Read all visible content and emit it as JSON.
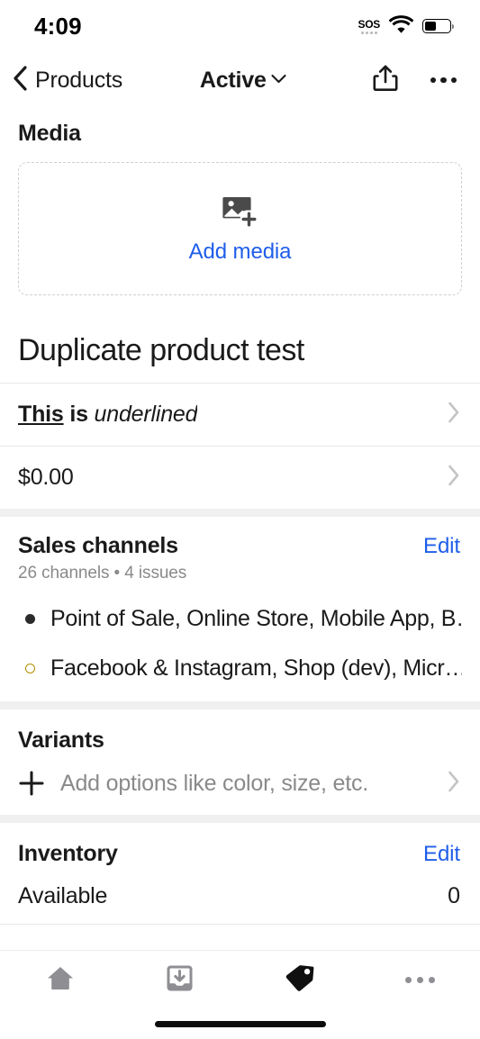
{
  "status_bar": {
    "time": "4:09",
    "sos_label": "SOS",
    "wifi_icon": "wifi-icon",
    "battery_icon": "battery-icon",
    "battery_level_percent": 45
  },
  "nav_bar": {
    "back_label": "Products",
    "back_icon": "chevron-left-icon",
    "status_label": "Active",
    "status_chevron_icon": "chevron-down-icon",
    "share_icon": "share-icon",
    "more_icon": "ellipsis-icon"
  },
  "media": {
    "title": "Media",
    "add_icon": "image-plus-icon",
    "add_label": "Add media"
  },
  "product": {
    "title": "Duplicate product test",
    "description": {
      "part_bold_underline": "This",
      "part_bold": "is",
      "part_italic": "underlined"
    },
    "price": "$0.00",
    "chevron_icon": "chevron-right-icon"
  },
  "sales_channels": {
    "title": "Sales channels",
    "edit_label": "Edit",
    "subtitle": "26 channels • 4 issues",
    "rows": [
      {
        "bullet": "filled-dot",
        "text": "Point of Sale, Online Store, Mobile App, B…"
      },
      {
        "bullet": "hollow-warning-dot",
        "text": "Facebook & Instagram, Shop (dev), Micr…"
      }
    ]
  },
  "variants": {
    "title": "Variants",
    "add_icon": "plus-icon",
    "add_placeholder": "Add options like color, size, etc.",
    "chevron_icon": "chevron-right-icon"
  },
  "inventory": {
    "title": "Inventory",
    "edit_label": "Edit",
    "available_label": "Available",
    "available_value": "0"
  },
  "tab_bar": {
    "items": [
      {
        "icon": "home-icon",
        "active": false
      },
      {
        "icon": "orders-inbox-icon",
        "active": false
      },
      {
        "icon": "product-tag-icon",
        "active": true
      },
      {
        "icon": "ellipsis-icon",
        "active": false
      }
    ]
  },
  "colors": {
    "link_blue": "#1f5eea",
    "warning_yellow": "#b08d00",
    "text_primary": "#1a1a1a",
    "text_muted": "#8a8a8a",
    "separator": "#f0f0f0",
    "tab_inactive": "#8e8e93",
    "tab_active": "#101010"
  }
}
